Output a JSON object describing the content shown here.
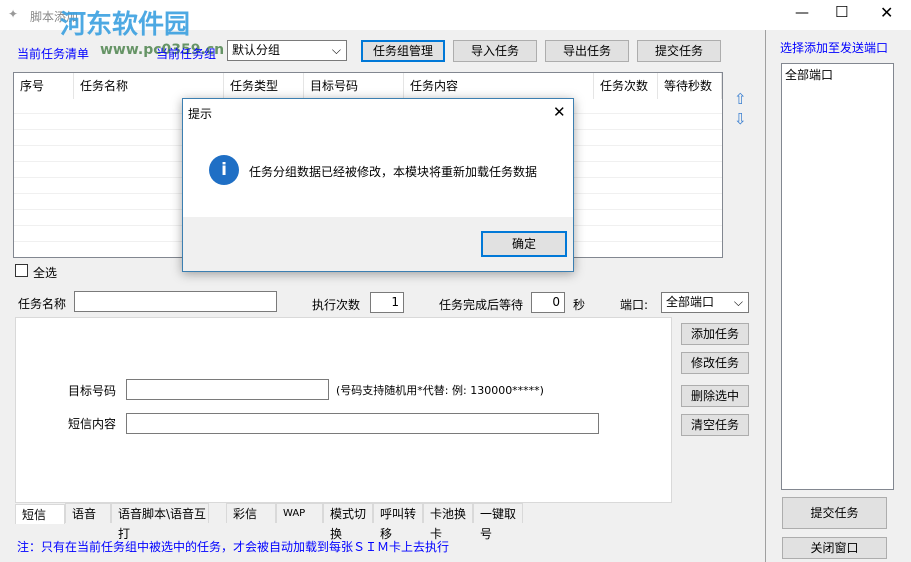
{
  "window": {
    "title": "脚本添加",
    "watermark": "河东软件园",
    "watermark_url": "www.pc0359.cn"
  },
  "toolbar": {
    "current_list_label": "当前任务清单",
    "current_group_label": "当前任务组",
    "group_select": "默认分组",
    "group_manage": "任务组管理",
    "import": "导入任务",
    "export": "导出任务",
    "submit": "提交任务"
  },
  "table": {
    "columns": [
      "序号",
      "任务名称",
      "任务类型",
      "目标号码",
      "任务内容",
      "任务次数",
      "等待秒数"
    ]
  },
  "select_all": "全选",
  "form": {
    "task_name_label": "任务名称",
    "task_name_value": "",
    "exec_count_label": "执行次数",
    "exec_count_value": "1",
    "wait_label": "任务完成后等待",
    "wait_value": "0",
    "seconds": "秒",
    "port_label": "端口:",
    "port_value": "全部端口",
    "target_label": "目标号码",
    "target_value": "",
    "target_hint": "(号码支持随机用*代替: 例: 130000*****)",
    "content_label": "短信内容",
    "content_value": ""
  },
  "side_buttons": {
    "add": "添加任务",
    "modify": "修改任务",
    "delete": "删除选中",
    "clear": "清空任务"
  },
  "tabs": [
    "短信",
    "语音",
    "语音脚本\\语音互打",
    "彩信",
    "WAP",
    "模式切换",
    "呼叫转移",
    "卡池换卡",
    "一键取号"
  ],
  "note": "注：只有在当前任务组中被选中的任务，才会被自动加载到每张ＳＩＭ卡上去执行",
  "right": {
    "title": "选择添加至发送端口",
    "ports": [
      "全部端口"
    ],
    "submit": "提交任务",
    "close": "关闭窗口"
  },
  "dialog": {
    "title": "提示",
    "message": "任务分组数据已经被修改，本模块将重新加载任务数据",
    "ok": "确定"
  }
}
